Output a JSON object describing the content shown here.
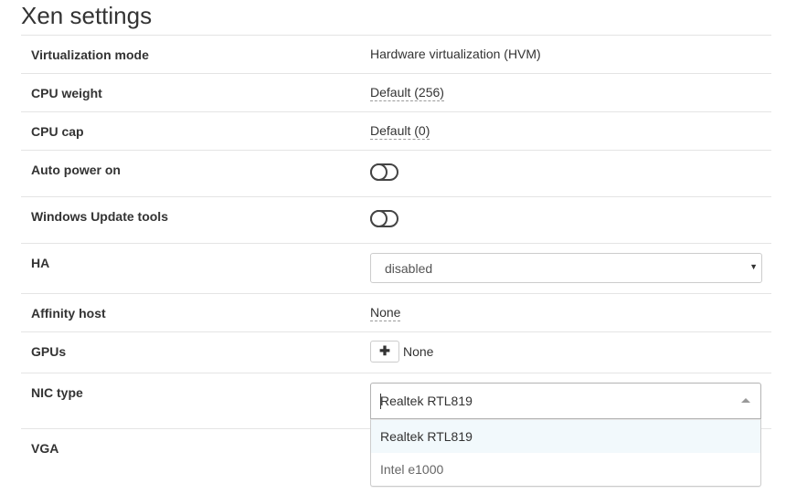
{
  "section_title": "Xen settings",
  "rows": {
    "virtualization_mode": {
      "label": "Virtualization mode",
      "value": "Hardware virtualization (HVM)"
    },
    "cpu_weight": {
      "label": "CPU weight",
      "value": "Default (256)"
    },
    "cpu_cap": {
      "label": "CPU cap",
      "value": "Default (0)"
    },
    "auto_power_on": {
      "label": "Auto power on",
      "state": "off"
    },
    "windows_update_tools": {
      "label": "Windows Update tools",
      "state": "off"
    },
    "ha": {
      "label": "HA",
      "selected": "disabled"
    },
    "affinity_host": {
      "label": "Affinity host",
      "value": "None"
    },
    "gpus": {
      "label": "GPUs",
      "add_symbol": "✚",
      "value": "None"
    },
    "nic_type": {
      "label": "NIC type",
      "input_value": "Realtek RTL819",
      "options": [
        "Realtek RTL819",
        "Intel e1000"
      ],
      "focused_option": "Realtek RTL819"
    },
    "vga": {
      "label": "VGA"
    }
  },
  "colors": {
    "row_border": "#e4e4e4",
    "option_focus_bg": "#f2f9fc",
    "text": "#333333"
  }
}
